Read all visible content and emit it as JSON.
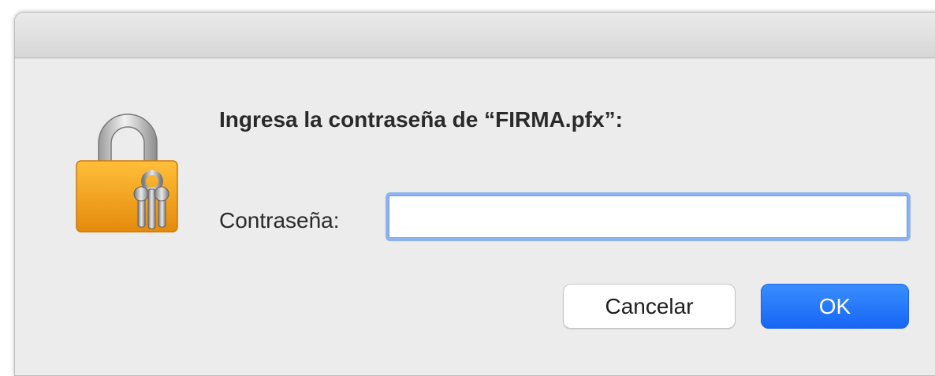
{
  "dialog": {
    "prompt": "Ingresa la contraseña de “FIRMA.pfx”:",
    "field_label": "Contraseña:",
    "password_value": "",
    "icon": "lock-with-keys-icon",
    "cancel_label": "Cancelar",
    "ok_label": "OK"
  },
  "colors": {
    "accent": "#1f73fb",
    "focus_ring": "#8eb2ec",
    "dialog_bg": "#ececec",
    "lock_body": "#f3a31a"
  }
}
